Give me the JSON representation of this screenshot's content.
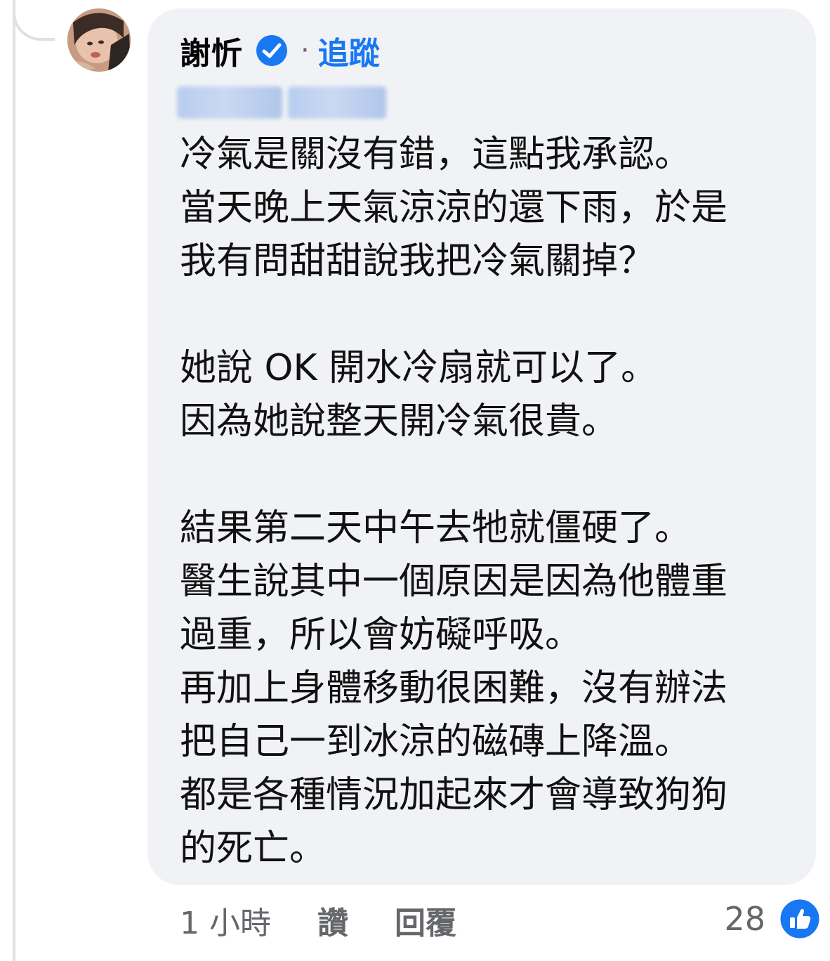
{
  "comment": {
    "author": "謝忻",
    "follow_label": "追蹤",
    "separator": "·",
    "lines": [
      "冷氣是關沒有錯，這點我承認。",
      "當天晚上天氣涼涼的還下雨，於是",
      "我有問甜甜說我把冷氣關掉？",
      "",
      "她說 OK 開水冷扇就可以了。",
      "因為她說整天開冷氣很貴。",
      "",
      "結果第二天中午去牠就僵硬了。",
      "醫生說其中一個原因是因為他體重",
      "過重，所以會妨礙呼吸。",
      "再加上身體移動很困難，沒有辦法",
      "把自己一到冰涼的磁磚上降溫。",
      "都是各種情況加起來才會導致狗狗",
      "的死亡。"
    ]
  },
  "footer": {
    "timestamp": "1 小時",
    "like_label": "讚",
    "reply_label": "回覆",
    "reaction_count": "28"
  },
  "icons": {
    "verified": "verified-badge-icon",
    "like": "thumbs-up-icon"
  },
  "colors": {
    "accent": "#1877f2",
    "bubble_bg": "#f0f2f5",
    "secondary_text": "#65676b"
  }
}
